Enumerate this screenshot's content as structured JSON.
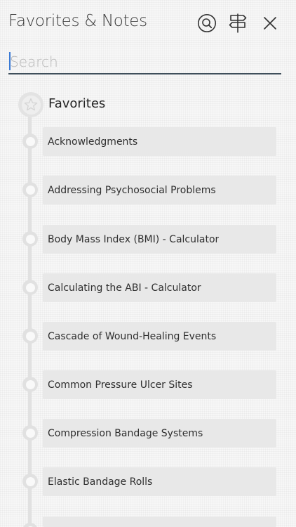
{
  "header": {
    "title": "Favorites & Notes",
    "search_button_icon": "search-icon",
    "signpost_button_icon": "signpost-icon",
    "close_button_icon": "close-icon"
  },
  "search": {
    "placeholder": "Search",
    "value": ""
  },
  "section": {
    "title": "Favorites",
    "icon": "star-icon"
  },
  "items": [
    {
      "label": "Acknowledgments"
    },
    {
      "label": "Addressing Psychosocial Problems"
    },
    {
      "label": "Body Mass Index (BMI) - Calculator"
    },
    {
      "label": "Calculating the ABI - Calculator"
    },
    {
      "label": "Cascade of Wound-Healing Events"
    },
    {
      "label": "Common Pressure Ulcer Sites"
    },
    {
      "label": "Compression Bandage Systems"
    },
    {
      "label": "Elastic Bandage Rolls"
    },
    {
      "label": ""
    }
  ],
  "colors": {
    "accent_cursor": "#3b7bd6",
    "search_underline": "#3f4f5b",
    "card_background": "#e8e8e8",
    "timeline": "#e1e1e1"
  }
}
